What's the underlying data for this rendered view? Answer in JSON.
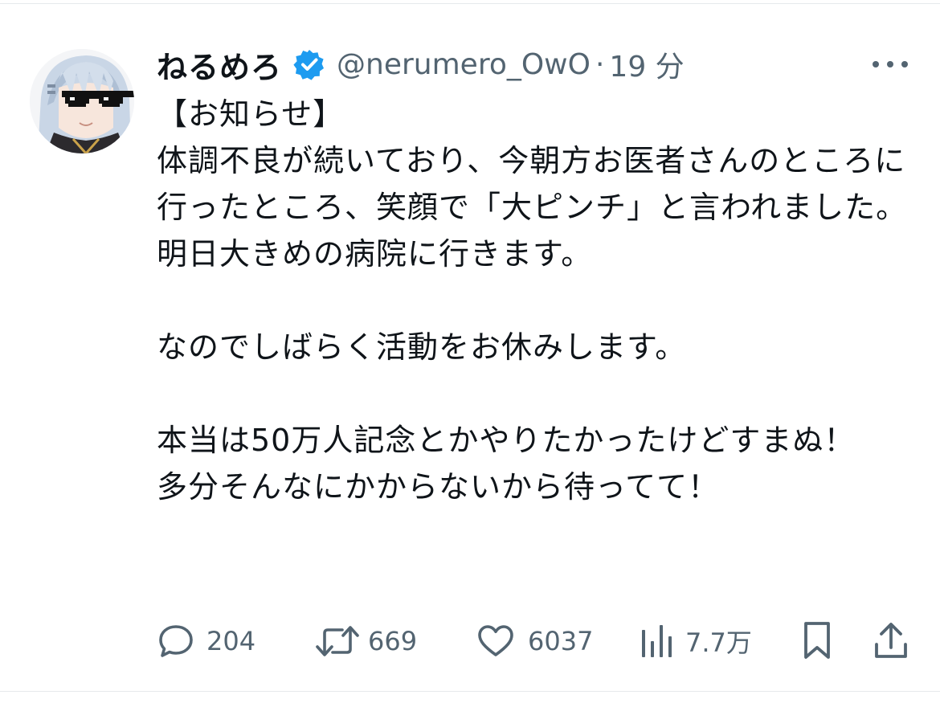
{
  "tweet": {
    "display_name": "ねるめろ",
    "handle": "@nerumero_OwO",
    "separator": "·",
    "time_ago": "19 分",
    "body": "【お知らせ】\n体調不良が続いており、今朝方お医者さんのところに行ったところ、笑顔で「大ピンチ」と言われました。\n明日大きめの病院に行きます。\n\nなのでしばらく活動をお休みします。\n\n本当は50万人記念とかやりたかったけどすまぬ！\n多分そんなにかからないから待ってて！"
  },
  "icons": {
    "verified": "verified-badge-icon",
    "more": "more-dots-icon",
    "reply": "reply-bubble-icon",
    "retweet": "retweet-icon",
    "like": "heart-icon",
    "views": "views-bar-chart-icon",
    "bookmark": "bookmark-icon",
    "share": "share-upload-icon"
  },
  "metrics": {
    "replies": "204",
    "retweets": "669",
    "likes": "6037",
    "views": "7.7万"
  },
  "colors": {
    "verified_blue": "#1d9bf0",
    "secondary_text": "#536471",
    "primary_text": "#0f1419"
  }
}
